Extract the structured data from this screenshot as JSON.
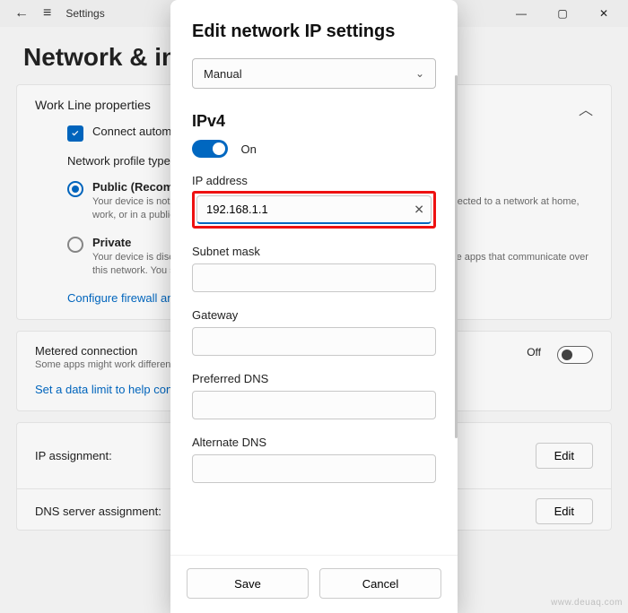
{
  "titlebar": {
    "title": "Settings"
  },
  "page": {
    "heading": "Network & internet  ›  Work Line"
  },
  "card1": {
    "title": "Work Line properties",
    "connect": "Connect automatically when in range",
    "profile_type": "Network profile type",
    "public_title": "Public (Recommended)",
    "public_desc": "Your device is not discoverable on the network. Use this in most cases—when connected to a network at home, work, or in a public place.",
    "private_title": "Private",
    "private_desc": "Your device is discoverable on the network. Select this if you need file sharing or use apps that communicate over this network. You should know and trust the people and devices on the network.",
    "firewall_link": "Configure firewall and security settings"
  },
  "metered": {
    "title": "Metered connection",
    "sub": "Some apps might work differently to reduce data usage when you're connected to this network.",
    "state": "Off",
    "limit_link": "Set a data limit to help control data usage on this network"
  },
  "ip_assign": {
    "label": "IP assignment:",
    "edit": "Edit"
  },
  "dns_assign": {
    "label": "DNS server assignment:",
    "edit": "Edit"
  },
  "dialog": {
    "title": "Edit network IP settings",
    "mode": "Manual",
    "ipv4": "IPv4",
    "ipv4_state": "On",
    "ip_label": "IP address",
    "ip_value": "192.168.1.1",
    "subnet_label": "Subnet mask",
    "gateway_label": "Gateway",
    "pref_dns_label": "Preferred DNS",
    "alt_dns_label": "Alternate DNS",
    "save": "Save",
    "cancel": "Cancel"
  },
  "watermark": "www.deuaq.com"
}
